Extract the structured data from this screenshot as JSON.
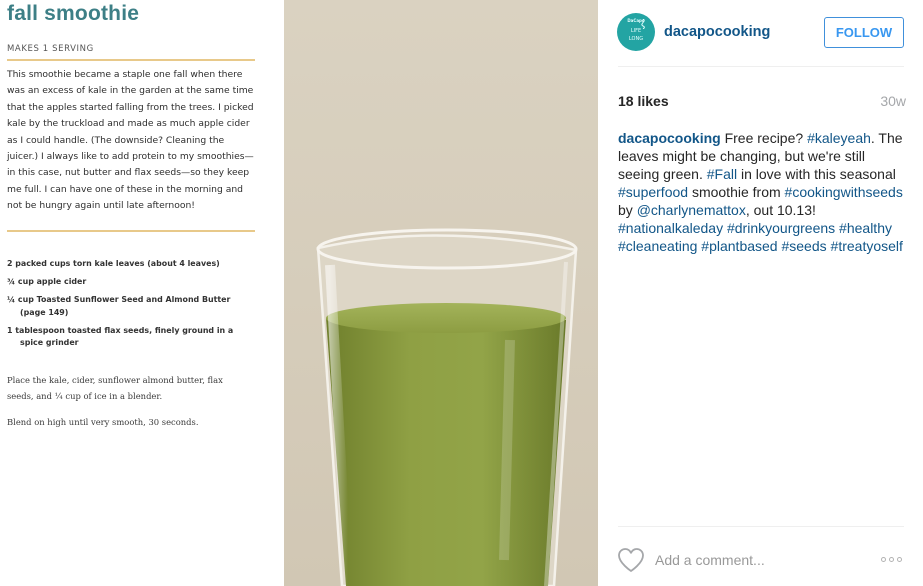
{
  "recipe": {
    "title": "fall smoothie",
    "serving": "MAKES 1 SERVING",
    "intro": "This smoothie became a staple one fall when there was an excess of kale in the garden at the same time that the apples started falling from the trees. I picked kale by the truckload and made as much apple cider as I could handle. (The downside? Cleaning the juicer.) I always like to add protein to my smoothies—in this case, nut butter and flax seeds—so they keep me full. I can have one of these in the morning and not be hungry again until late afternoon!",
    "ingredients": [
      "2 packed cups torn kale leaves (about 4 leaves)",
      "¾ cup apple cider",
      "¼ cup Toasted Sunflower Seed and Almond Butter (page 149)",
      "1 tablespoon toasted flax seeds, finely ground in a spice grinder"
    ],
    "steps": [
      "Place the kale, cider, sunflower almond butter, flax seeds, and ¼ cup of ice in a blender.",
      "Blend on high until very smooth, 30 seconds."
    ]
  },
  "avatar": {
    "line1": "DaCapo",
    "line2": "LIFE",
    "line3": "LONG"
  },
  "post": {
    "username": "dacapocooking",
    "follow_label": "FOLLOW",
    "likes": "18 likes",
    "age": "30w",
    "caption": {
      "user": "dacapocooking",
      "t1": " Free recipe? ",
      "h1": "#kaleyeah",
      "t2": ". The leaves might be changing, but we're still seeing green. ",
      "h2": "#Fall",
      "t3": " in love with this seasonal ",
      "h3": "#superfood",
      "t4": " smoothie from ",
      "h4": "#cookingwithseeds",
      "t5": " by ",
      "m1": "@charlynemattox",
      "t6": ", out 10.13! ",
      "h5": "#nationalkaleday",
      "t7": " ",
      "h6": "#drinkyourgreens",
      "t8": " ",
      "h7": "#healthy",
      "t9": " ",
      "h8": "#cleaneating",
      "t10": " ",
      "h9": "#plantbased",
      "t11": " ",
      "h10": "#seeds",
      "t12": " ",
      "h11": "#treatyoself"
    },
    "comment_placeholder": "Add a comment...",
    "icons": {
      "like": "heart-icon",
      "more": "more-options-icon"
    }
  },
  "colors": {
    "link": "#125688",
    "follow": "#3897f0",
    "recipe_title": "#3d7f86",
    "avatar_bg": "#23a4a3",
    "smoothie": "#8a9a3f"
  }
}
